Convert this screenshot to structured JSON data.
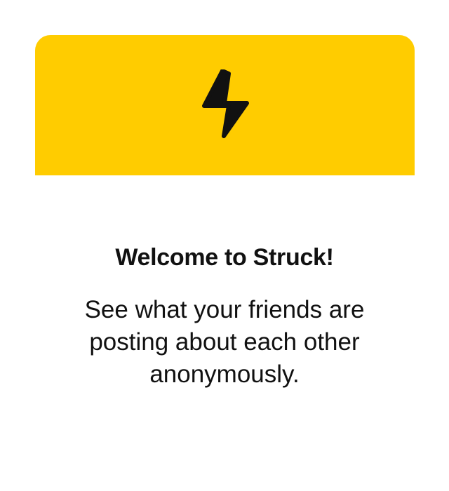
{
  "theme": {
    "banner_color": "#FFCC00",
    "icon_color": "#111111",
    "background": "#FFFFFF"
  },
  "hero": {
    "icon": "lightning-bolt-icon"
  },
  "welcome": {
    "title": "Welcome to Struck!",
    "body": "See what your friends are posting about each other anonymously."
  }
}
